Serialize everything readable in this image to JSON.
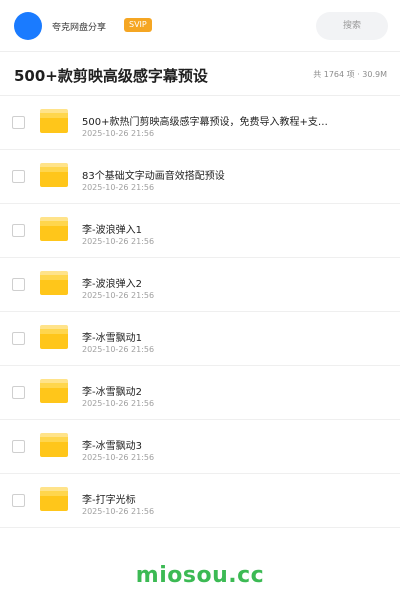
{
  "header": {
    "brand": "夸克网盘分享",
    "vip": "SVIP",
    "search_label": "搜索"
  },
  "folder": {
    "title": "500+款剪映高级感字幕预设",
    "meta": "共 1764 项 · 30.9M"
  },
  "files": [
    {
      "name": "500+款热门剪映高级感字幕预设，免费导入教程+支…",
      "date": "2025-10-26 21:56"
    },
    {
      "name": "83个基础文字动画音效搭配预设",
      "date": "2025-10-26 21:56"
    },
    {
      "name": "李-波浪弹入1",
      "date": "2025-10-26 21:56"
    },
    {
      "name": "李-波浪弹入2",
      "date": "2025-10-26 21:56"
    },
    {
      "name": "李-冰雪飘动1",
      "date": "2025-10-26 21:56"
    },
    {
      "name": "李-冰雪飘动2",
      "date": "2025-10-26 21:56"
    },
    {
      "name": "李-冰雪飘动3",
      "date": "2025-10-26 21:56"
    },
    {
      "name": "李-打字光标",
      "date": "2025-10-26 21:56"
    }
  ],
  "footer": {
    "watermark": "miosou.cc"
  },
  "colors": {
    "accent_blue": "#1a7bff",
    "vip_orange": "#f5a623",
    "folder_yellow": "#ffc61a",
    "watermark_green": "#3cba54"
  },
  "icons": {
    "avatar": "avatar-circle",
    "row_checkbox": "checkbox",
    "row_icon": "folder-icon"
  }
}
